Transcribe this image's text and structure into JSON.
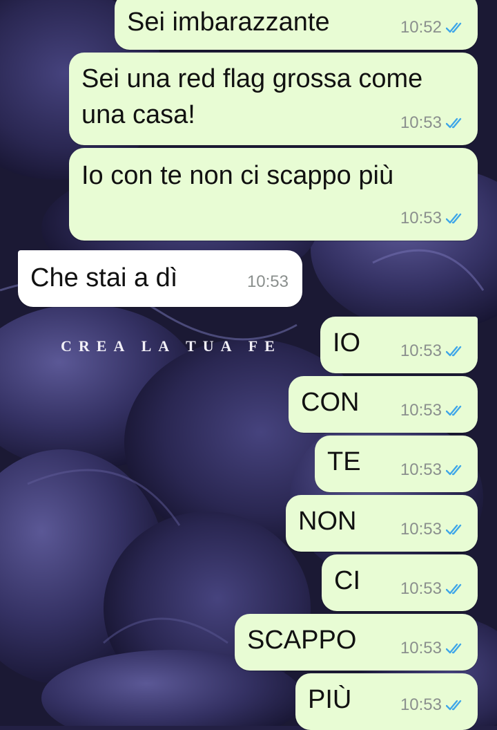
{
  "colors": {
    "outgoing_bubble": "#e8fcd4",
    "incoming_bubble": "#ffffff",
    "read_ticks": "#3ea6e8",
    "background": "#232044"
  },
  "wallpaper": {
    "watermark_text": "CREA LA TUA FE"
  },
  "messages": [
    {
      "direction": "outgoing",
      "text": "Sei imbarazzante",
      "time": "10:52",
      "status": "read"
    },
    {
      "direction": "outgoing",
      "text_line1": "Sei una red flag grossa come",
      "text_line2": "una casa!",
      "time": "10:53",
      "status": "read"
    },
    {
      "direction": "outgoing",
      "text": "Io con te non ci scappo più",
      "time": "10:53",
      "status": "read"
    },
    {
      "direction": "incoming",
      "text": "Che stai a dì",
      "time": "10:53"
    },
    {
      "direction": "outgoing",
      "text": "IO",
      "time": "10:53",
      "status": "read"
    },
    {
      "direction": "outgoing",
      "text": "CON",
      "time": "10:53",
      "status": "read"
    },
    {
      "direction": "outgoing",
      "text": "TE",
      "time": "10:53",
      "status": "read"
    },
    {
      "direction": "outgoing",
      "text": "NON",
      "time": "10:53",
      "status": "read"
    },
    {
      "direction": "outgoing",
      "text": "CI",
      "time": "10:53",
      "status": "read"
    },
    {
      "direction": "outgoing",
      "text": "SCAPPO",
      "time": "10:53",
      "status": "read"
    },
    {
      "direction": "outgoing",
      "text": "PIÙ",
      "time": "10:53",
      "status": "read"
    }
  ]
}
